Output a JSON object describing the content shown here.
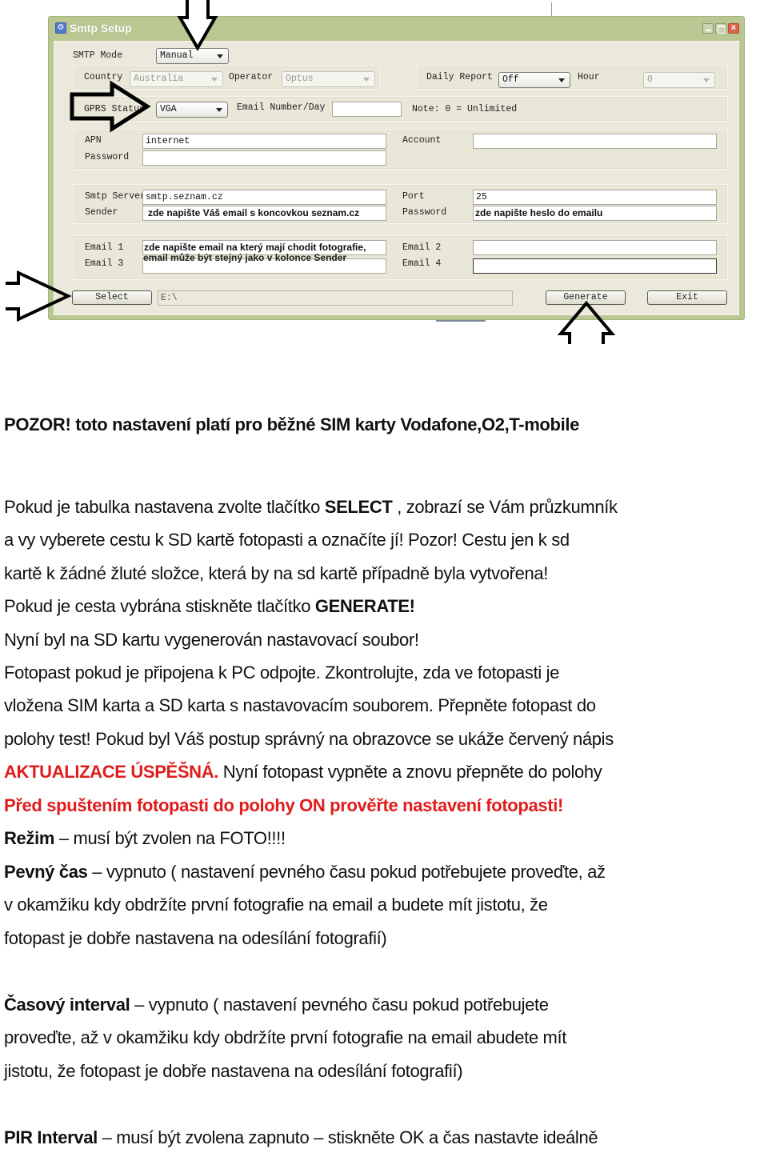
{
  "window": {
    "title": "Smtp Setup",
    "icon": "gear-icon",
    "controls": {
      "minimize": "minimize-icon",
      "maximize": "maximize-icon",
      "close": "close-icon"
    }
  },
  "form": {
    "smtp_mode": {
      "label": "SMTP Mode",
      "value": "Manual"
    },
    "country": {
      "label": "Country",
      "value": "Australia"
    },
    "operator": {
      "label": "Operator",
      "value": "Optus"
    },
    "daily_report": {
      "label": "Daily Report",
      "value": "Off"
    },
    "hour": {
      "label": "Hour",
      "value": "0"
    },
    "gprs_status": {
      "label": "GPRS Status",
      "value": "VGA"
    },
    "email_number": {
      "label": "Email Number/Day",
      "value": ""
    },
    "note": "Note: 0 = Unlimited",
    "apn": {
      "label": "APN",
      "value": "internet"
    },
    "apn_password": {
      "label": "Password",
      "value": ""
    },
    "account": {
      "label": "Account",
      "value": ""
    },
    "smtp_server": {
      "label": "Smtp Server",
      "value": "smtp.seznam.cz"
    },
    "sender": {
      "label": "Sender",
      "value": "zde napište Váš email s koncovkou seznam.cz"
    },
    "port": {
      "label": "Port",
      "value": "25"
    },
    "smtp_password": {
      "label": "Password",
      "value": "zde napište heslo do emailu"
    },
    "email1": {
      "label": "Email 1",
      "value": "zde napište email na který mají chodit fotografie,"
    },
    "email3": {
      "label": "Email 3",
      "value": ""
    },
    "email_overlay": "email může být stejný jako v kolonce Sender",
    "email2": {
      "label": "Email 2",
      "value": ""
    },
    "email4": {
      "label": "Email 4",
      "value": ""
    },
    "path": {
      "value": "E:\\"
    },
    "buttons": {
      "select": "Select",
      "generate": "Generate",
      "exit": "Exit"
    }
  },
  "document": {
    "warning": "POZOR! toto nastavení platí pro běžné SIM karty Vodafone,O2,T-mobile",
    "p1": {
      "l1a": "Pokud je tabulka nastavena zvolte tlačítko ",
      "l1b": "SELECT",
      "l1c": " , zobrazí se Vám průzkumník",
      "l2": "a vy vyberete cestu k SD kartě fotopasti a označíte jí! Pozor! Cestu jen k sd",
      "l3": "kartě k žádné žluté složce, která by na sd kartě případně byla vytvořena!",
      "l4a": "Pokud je cesta vybrána stiskněte tlačítko ",
      "l4b": "GENERATE!",
      "l5": "Nyní byl na SD kartu vygenerován nastavovací soubor!",
      "l6": "Fotopast pokud je připojena k PC odpojte. Zkontrolujte, zda ve fotopasti je",
      "l7": "vložena SIM karta a SD karta s nastavovacím souborem. Přepněte fotopast do",
      "l8": "polohy test! Pokud byl Váš postup správný na obrazovce se ukáže červený nápis",
      "l9a": "AKTUALIZACE ÚSPĚŠNÁ.",
      "l9b": " Nyní fotopast vypněte a znovu přepněte do polohy",
      "l10": "Před spuštením fotopasti do polohy ON prověřte nastavení fotopasti!",
      "l11a": "Režim",
      "l11b": " – musí být zvolen na FOTO!!!!",
      "l12a": "Pevný čas",
      "l12b": " – vypnuto ( nastavení pevného času pokud potřebujete proveďte, až",
      "l13": "v okamžiku kdy obdržíte první fotografie na email a budete mít jistotu, že",
      "l14": "fotopast je dobře nastavena na odesílání fotografií)"
    },
    "p2": {
      "l1a": "Časový interval",
      "l1b": " – vypnuto ( nastavení pevného času pokud potřebujete",
      "l2": "proveďte, až v okamžiku kdy obdržíte první fotografie na email abudete mít",
      "l3": "jistotu, že fotopast je dobře nastavena na odesílání fotografií)"
    },
    "p3": {
      "l1a": "PIR Interval",
      "l1b": " – musí být zvolena zapnuto – stiskněte OK a čas nastavte ideálně"
    },
    "colors": {
      "red": "#e01b1b",
      "window_frame": "#b9c893",
      "window_client": "#ebe9db"
    }
  }
}
